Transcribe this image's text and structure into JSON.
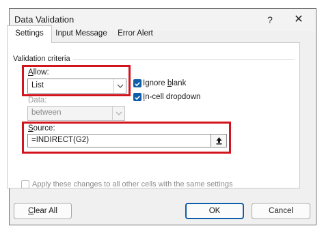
{
  "window": {
    "title": "Data Validation",
    "help": "?",
    "close": "✕"
  },
  "tabs": [
    {
      "label": "Settings",
      "active": true
    },
    {
      "label": "Input Message",
      "active": false
    },
    {
      "label": "Error Alert",
      "active": false
    }
  ],
  "criteria": {
    "group_label": "Validation criteria",
    "allow": {
      "label_mnemonic": "A",
      "label_rest": "llow:",
      "value": "List"
    },
    "data": {
      "label": "Data:",
      "value": "between",
      "enabled": false
    },
    "source": {
      "label_mnemonic": "S",
      "label_rest": "ource:",
      "value": "=INDIRECT(G2)"
    }
  },
  "options": {
    "ignore_blank": {
      "label_mnemonic": "b",
      "label_before": "Ignore ",
      "label_after": "lank",
      "checked": true
    },
    "in_cell_dropdown": {
      "label_mnemonic": "I",
      "label_rest": "n-cell dropdown",
      "checked": true
    },
    "apply_all": {
      "label": "Apply these changes to all other cells with the same settings",
      "checked": false,
      "enabled": false
    }
  },
  "buttons": {
    "clear_all": {
      "mnemonic": "C",
      "rest": "lear All"
    },
    "ok": "OK",
    "cancel": "Cancel"
  },
  "colors": {
    "highlight": "#d2141e",
    "accent": "#0f5ea8"
  }
}
